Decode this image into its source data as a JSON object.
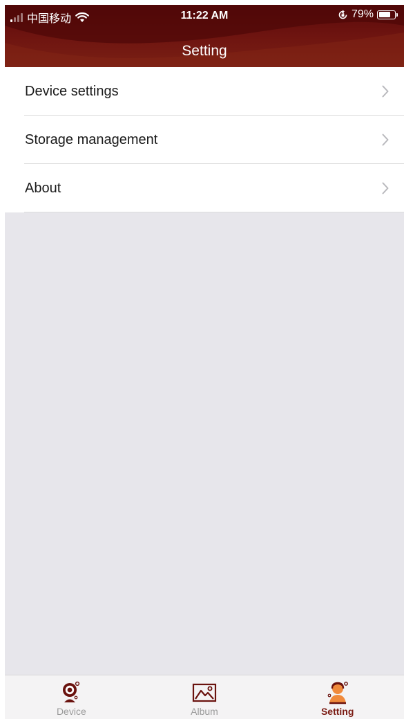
{
  "status_bar": {
    "carrier": "中国移动",
    "time": "11:22 AM",
    "battery": "79%",
    "battery_level": 0.79
  },
  "header": {
    "title": "Setting"
  },
  "menu": {
    "items": [
      {
        "label": "Device settings"
      },
      {
        "label": "Storage management"
      },
      {
        "label": "About"
      }
    ]
  },
  "tab_bar": {
    "tabs": [
      {
        "label": "Device",
        "icon": "webcam-icon",
        "active": false
      },
      {
        "label": "Album",
        "icon": "image-icon",
        "active": false
      },
      {
        "label": "Setting",
        "icon": "person-icon",
        "active": true
      }
    ]
  },
  "colors": {
    "header": "#6e1410",
    "accent": "#7a1a12",
    "background": "#e7e6eb",
    "active_icon": "#f08a3c"
  }
}
